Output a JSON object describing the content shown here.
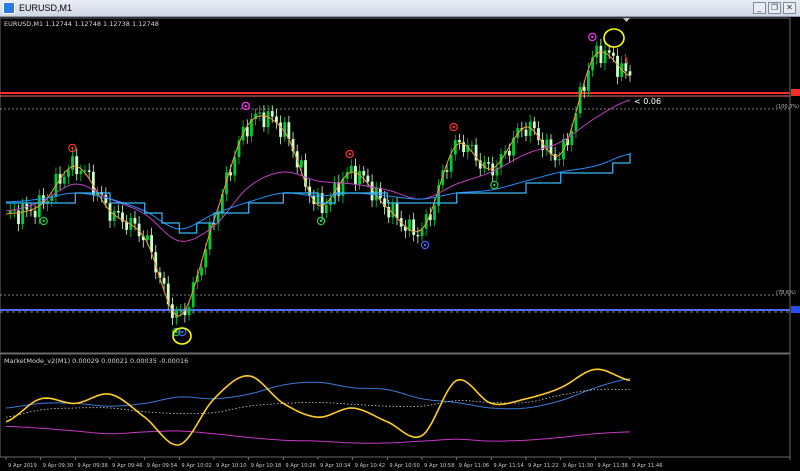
{
  "window": {
    "title": "EURUSD,M1",
    "controls": [
      "minimize-icon",
      "restore-icon",
      "close-icon"
    ]
  },
  "main": {
    "info": "EURUSD,M1  1.12744 1.12748 1.12738 1.12748",
    "pip_label": "< 0.06",
    "level_top_label": "(100.0%)",
    "level_bottom_label": "(78.6%)"
  },
  "sub": {
    "label": "MarketMode_v2(M1)  0.00029 0.00021 0.00035 -0.00016"
  },
  "chart_data": [
    {
      "type": "line",
      "title": "EURUSD,M1",
      "x": [
        "9 Apr 2019",
        "9 Apr 09:30",
        "9 Apr 09:38",
        "9 Apr 09:46",
        "9 Apr 09:54",
        "9 Apr 10:02",
        "9 Apr 10:10",
        "9 Apr 10:18",
        "9 Apr 10:26",
        "9 Apr 10:34",
        "9 Apr 10:42",
        "9 Apr 10:50",
        "9 Apr 10:58",
        "9 Apr 11:06",
        "9 Apr 11:14",
        "9 Apr 11:22",
        "9 Apr 11:30",
        "9 Apr 11:38",
        "9 Apr 11:46"
      ],
      "series": [
        {
          "values": [
            0.42,
            0.45,
            0.58,
            0.43,
            0.34,
            0.08,
            0.4,
            0.72,
            0.7,
            0.45,
            0.56,
            0.44,
            0.37,
            0.65,
            0.57,
            0.71,
            0.62,
            0.95,
            0.88
          ]
        },
        {
          "values": [
            0.43,
            0.46,
            0.52,
            0.47,
            0.42,
            0.33,
            0.38,
            0.51,
            0.56,
            0.53,
            0.52,
            0.5,
            0.47,
            0.52,
            0.56,
            0.62,
            0.66,
            0.74,
            0.8
          ]
        },
        {
          "values": [
            0.46,
            0.47,
            0.49,
            0.47,
            0.43,
            0.37,
            0.42,
            0.46,
            0.49,
            0.48,
            0.49,
            0.48,
            0.47,
            0.49,
            0.5,
            0.53,
            0.56,
            0.58,
            0.62
          ]
        }
      ],
      "levels": [
        0.82,
        0.8,
        0.15
      ]
    },
    {
      "type": "line",
      "title": "MarketMode_v2(M1)",
      "x": [
        "9 Apr 2019",
        "9 Apr 09:30",
        "9 Apr 09:38",
        "9 Apr 09:46",
        "9 Apr 09:54",
        "9 Apr 10:02",
        "9 Apr 10:10",
        "9 Apr 10:18",
        "9 Apr 10:26",
        "9 Apr 10:34",
        "9 Apr 10:42",
        "9 Apr 10:50",
        "9 Apr 10:58",
        "9 Apr 11:06",
        "9 Apr 11:14",
        "9 Apr 11:22",
        "9 Apr 11:30",
        "9 Apr 11:38",
        "9 Apr 11:46"
      ],
      "series": [
        {
          "values": [
            0.35,
            0.6,
            0.55,
            0.65,
            0.4,
            0.1,
            0.6,
            0.85,
            0.55,
            0.4,
            0.5,
            0.35,
            0.2,
            0.8,
            0.55,
            0.6,
            0.72,
            0.92,
            0.8
          ]
        },
        {
          "values": [
            0.5,
            0.55,
            0.55,
            0.52,
            0.55,
            0.62,
            0.6,
            0.65,
            0.75,
            0.78,
            0.72,
            0.7,
            0.6,
            0.56,
            0.5,
            0.5,
            0.58,
            0.72,
            0.82
          ]
        },
        {
          "values": [
            0.4,
            0.48,
            0.5,
            0.5,
            0.46,
            0.44,
            0.45,
            0.52,
            0.55,
            0.56,
            0.54,
            0.52,
            0.52,
            0.58,
            0.56,
            0.56,
            0.64,
            0.7,
            0.7
          ]
        },
        {
          "values": [
            0.3,
            0.28,
            0.25,
            0.22,
            0.24,
            0.25,
            0.22,
            0.18,
            0.15,
            0.14,
            0.12,
            0.12,
            0.14,
            0.16,
            0.14,
            0.15,
            0.18,
            0.22,
            0.24
          ]
        }
      ]
    }
  ],
  "colors": {
    "bull": "#00cc33",
    "bear": "#ccffcc",
    "fast": "#f0a030",
    "mid": "#c040c0",
    "slow": "#1e90ff",
    "kijun": "#38b8f8",
    "res": "#ff2a2a",
    "sup": "#4a6cff",
    "osc": "#ffcc22",
    "osc_blue": "#3a7ad8",
    "osc_dots": "#d0d0d0",
    "osc_mag": "#c838c8",
    "grid": "#5a5a5a",
    "text": "#c8c8c8"
  }
}
